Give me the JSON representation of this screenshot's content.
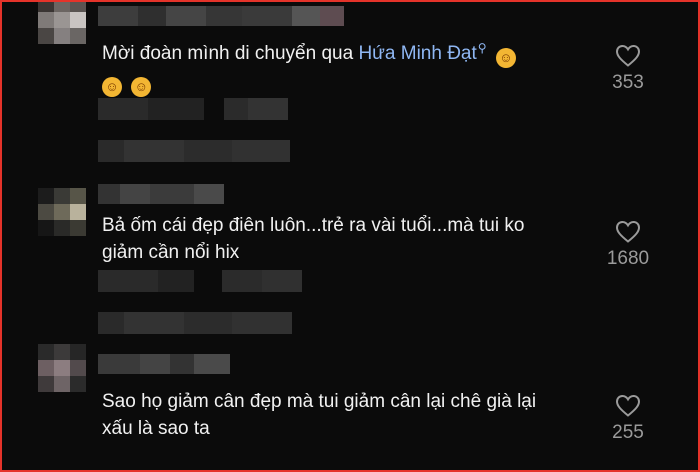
{
  "comments": [
    {
      "text_pre": "Mời đoàn mình di chuyển qua ",
      "mention": "Hứa Minh Đạt",
      "mention_icon": "search-icon",
      "emoji": "rolling-on-floor-laughing",
      "likes": "353"
    },
    {
      "line1": "Bả ốm cái đẹp điên luôn...trẻ ra vài tuổi...mà tui ko",
      "line2": "giảm cần nổi hix",
      "likes": "1680"
    },
    {
      "line1": "Sao họ giảm cân đẹp mà tui giảm cân lại chê già lại",
      "line2": "xấu là sao ta",
      "likes": "255"
    }
  ],
  "colors": {
    "background": "#0b0b0b",
    "text": "#f1f1f1",
    "mention": "#8fb7f3",
    "count": "#9b9b9b",
    "frame_border": "#e5332a"
  }
}
